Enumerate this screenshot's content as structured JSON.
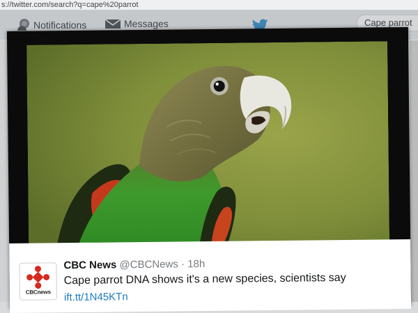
{
  "browser": {
    "url": "s://twitter.com/search?q=cape%20parrot"
  },
  "nav": {
    "notifications_label": "Notifications",
    "messages_label": "Messages",
    "search_value": "Cape parrot"
  },
  "tweet": {
    "display_name": "CBC News",
    "handle": "@CBCNews",
    "separator": "·",
    "time": "18h",
    "text": "Cape parrot DNA shows it's a new species, scientists say",
    "link": "ift.tt/1N45KTn",
    "avatar_wordmark": "CBCnews"
  },
  "colors": {
    "twitter_blue": "#55acee",
    "link_blue": "#1b7bbf",
    "cbc_red": "#d52b1e"
  },
  "icons": [
    "notifications-icon",
    "messages-icon",
    "twitter-bird-icon",
    "cbc-gem-icon"
  ]
}
